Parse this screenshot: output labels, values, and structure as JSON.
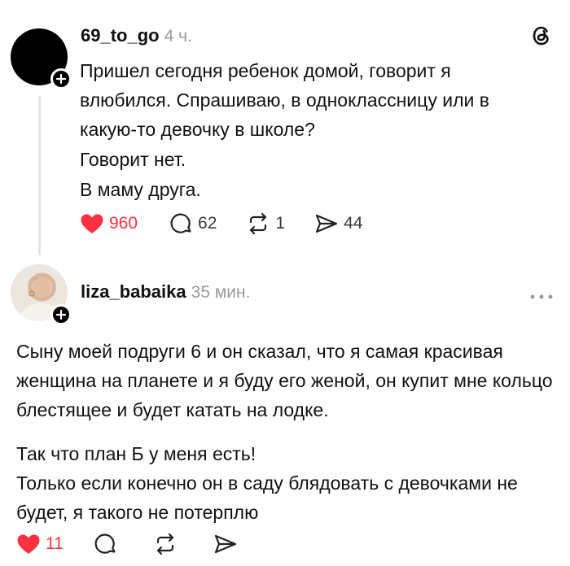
{
  "posts": [
    {
      "username": "69_to_go",
      "time": "4 ч.",
      "paragraphs": [
        "Пришел сегодня ребенок домой, говорит я влюбился. Спрашиваю, в одноклассницу или в какую-то девочку в школе?",
        "Говорит нет.",
        "В маму друга."
      ],
      "likes": "960",
      "comments": "62",
      "reposts": "1",
      "shares": "44"
    },
    {
      "username": "liza_babaika",
      "time": "35 мин.",
      "paragraphs": [
        "Сыну моей подруги 6 и он сказал, что я самая красивая женщина на планете и я буду его женой, он купит мне кольцо блестящее и будет катать на лодке.",
        "Так что план Б у меня есть!\nТолько если конечно он в саду блядовать с девочками не будет, я такого не потерплю"
      ],
      "likes": "11"
    }
  ],
  "colors": {
    "like": "#ff3040",
    "muted": "#9a9a9a",
    "text": "#111111"
  },
  "icons": [
    "threads-logo-icon",
    "heart-icon",
    "comment-icon",
    "repost-icon",
    "share-icon",
    "more-icon",
    "follow-plus-icon"
  ]
}
